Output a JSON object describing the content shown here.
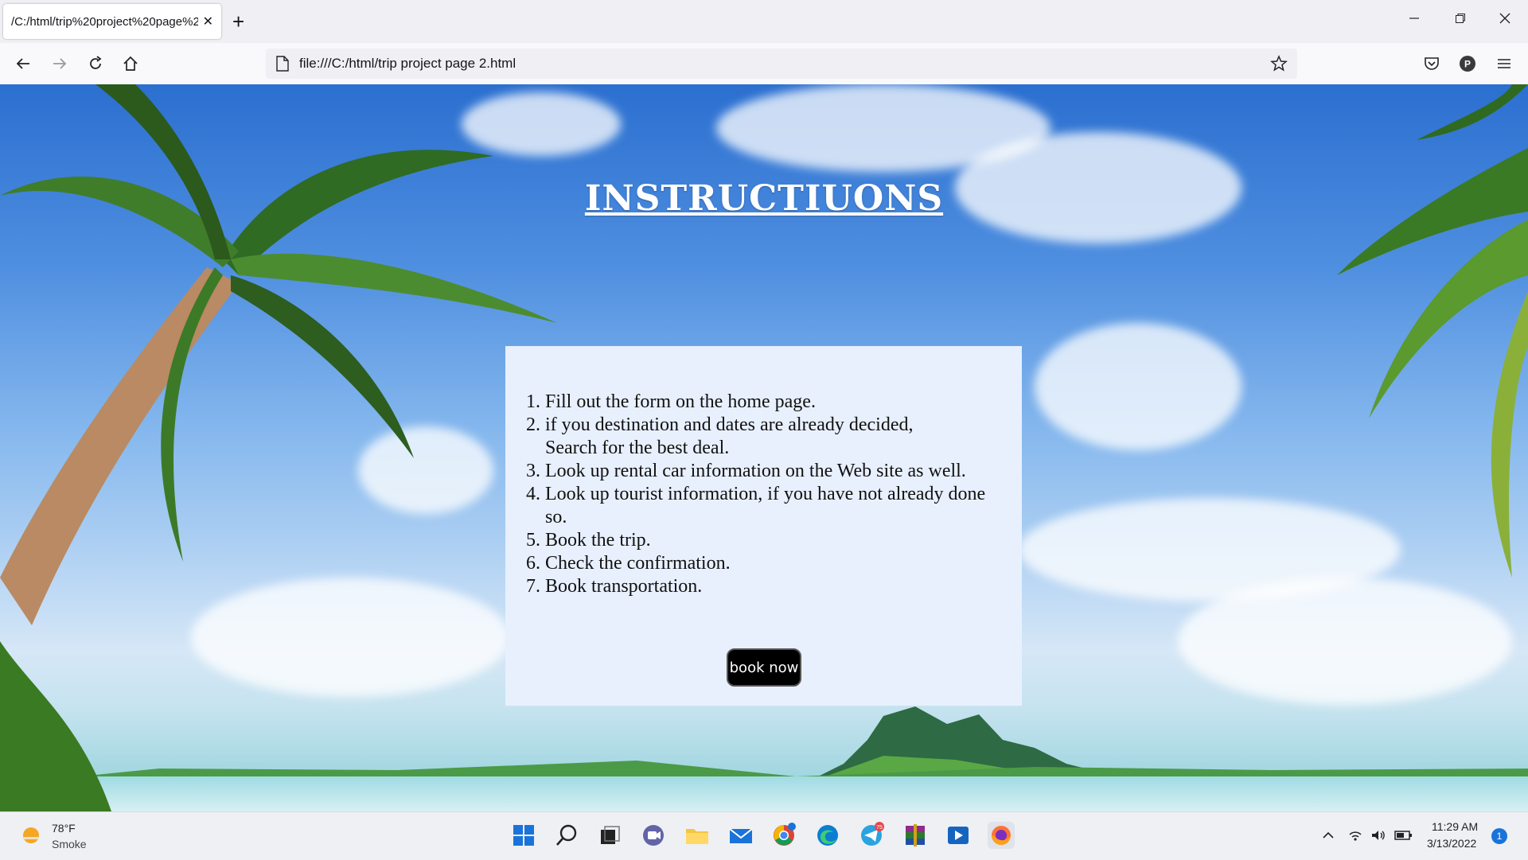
{
  "browser": {
    "tab_title": "/C:/html/trip%20project%20page%2",
    "tab_close": "✕",
    "new_tab": "+",
    "url": "file:///C:/html/trip project page 2.html"
  },
  "page": {
    "heading": "INSTRUCTIUONS",
    "steps": [
      "Fill out the form on the home page.",
      "if you destination and dates are already decided, Search for the best deal.",
      "Look up rental car information on the Web site as well.",
      "Look up tourist information, if you have not already done so.",
      "Book the trip.",
      "Check the confirmation.",
      "Book transportation."
    ],
    "book_button": "book now"
  },
  "taskbar": {
    "weather_temp": "78°F",
    "weather_desc": "Smoke",
    "time": "11:29 AM",
    "date": "3/13/2022",
    "notification_count": "1",
    "telegram_badge": "75"
  },
  "colors": {
    "panel_bg": "#e8f0fe",
    "button_bg": "#000000",
    "heading": "#ffffff"
  }
}
